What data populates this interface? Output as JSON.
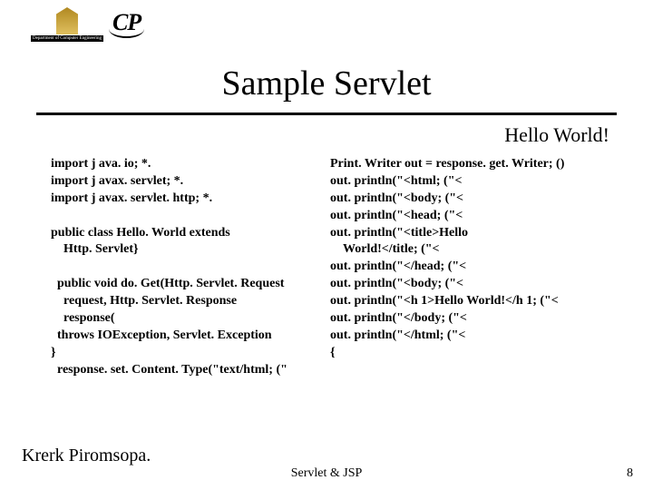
{
  "logos": {
    "dept_caption": "Department of Computer Engineering",
    "cp_text": "CP"
  },
  "title": "Sample Servlet",
  "subtitle": "Hello World!",
  "code": {
    "left": "import j ava. io; *.\nimport j avax. servlet; *.\nimport j avax. servlet. http; *.\n\npublic class Hello. World extends\n    Http. Servlet}\n\n  public void do. Get(Http. Servlet. Request\n    request, Http. Servlet. Response\n    response(\n  throws IOException, Servlet. Exception\n}\n  response. set. Content. Type(\"text/html; (\"",
    "right": "Print. Writer out = response. get. Writer; ()\nout. println(\"<html; (\"<\nout. println(\"<body; (\"<\nout. println(\"<head; (\"<\nout. println(\"<title>Hello\n    World!</title; (\"<\nout. println(\"</head; (\"<\nout. println(\"<body; (\"<\nout. println(\"<h 1>Hello World!</h 1; (\"<\nout. println(\"</body; (\"<\nout. println(\"</html; (\"<\n{"
  },
  "author": "Krerk Piromsopa.",
  "footer": "Servlet & JSP",
  "page": "8"
}
